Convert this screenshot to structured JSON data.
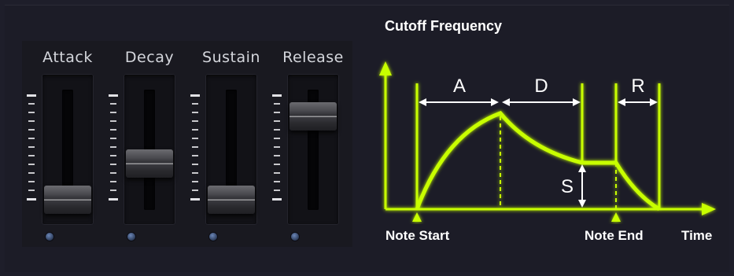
{
  "faders": [
    {
      "label": "Attack",
      "level": 0.0
    },
    {
      "label": "Decay",
      "level": 0.35
    },
    {
      "label": "Sustain",
      "level": 0.0
    },
    {
      "label": "Release",
      "level": 0.8
    }
  ],
  "diagram": {
    "title": "Cutoff Frequency",
    "segments": {
      "attack": "A",
      "decay": "D",
      "release": "R",
      "sustain": "S"
    },
    "captions": {
      "note_start": "Note Start",
      "note_end": "Note End",
      "time": "Time"
    },
    "accent_color": "#c8ff00"
  }
}
